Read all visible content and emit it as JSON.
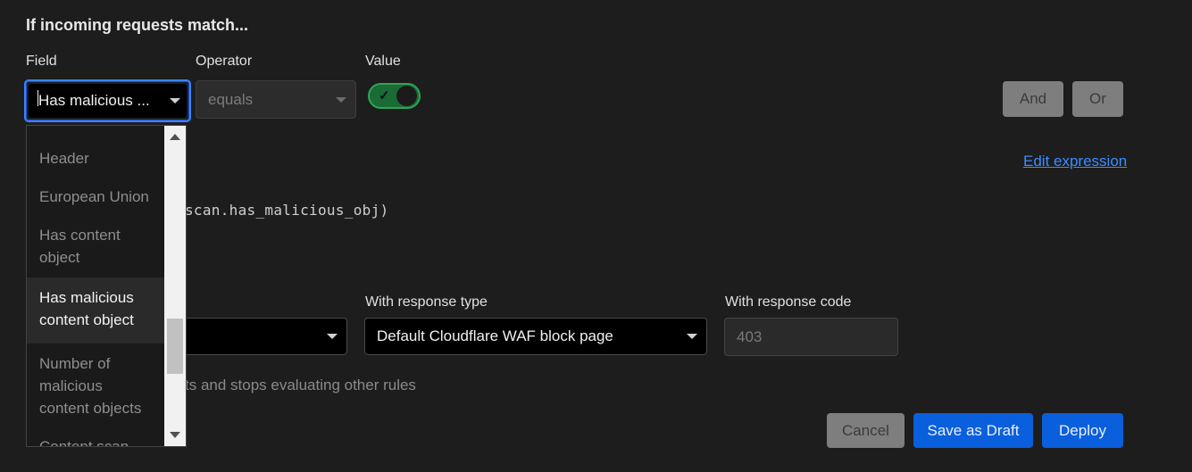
{
  "section_title": "If incoming requests match...",
  "field": {
    "label": "Field",
    "value": "Has malicious ..."
  },
  "operator": {
    "label": "Operator",
    "value": "equals"
  },
  "value": {
    "label": "Value",
    "toggle_on": true
  },
  "buttons": {
    "and": "And",
    "or": "Or",
    "cancel": "Cancel",
    "save_draft": "Save as Draft",
    "deploy": "Deploy"
  },
  "edit_expression": "Edit expression",
  "expression_fragment": "scan.has_malicious_obj)",
  "response_type": {
    "label": "With response type",
    "value": "Default Cloudflare WAF block page"
  },
  "response_code": {
    "label": "With response code",
    "placeholder": "403"
  },
  "helper_fragment": "ts and stops evaluating other rules",
  "dropdown": {
    "items": [
      {
        "label": "Header",
        "selected": false
      },
      {
        "label": "European Union",
        "selected": false
      },
      {
        "label": "Has content object",
        "selected": false
      },
      {
        "label": "Has malicious content object",
        "selected": true
      },
      {
        "label": "Number of malicious content objects",
        "selected": false
      },
      {
        "label": "Content scan",
        "selected": false
      }
    ]
  },
  "colors": {
    "background": "#1d1d1d",
    "accent_blue": "#0a5fdc",
    "toggle_green": "#1a6b36",
    "link": "#3b8cff"
  }
}
